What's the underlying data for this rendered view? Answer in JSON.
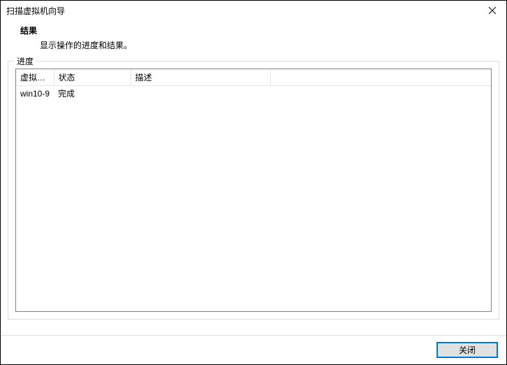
{
  "window": {
    "title": "扫描虚拟机向导"
  },
  "header": {
    "title": "结果",
    "subtitle": "显示操作的进度和结果。"
  },
  "groupbox": {
    "label": "进度"
  },
  "table": {
    "columns": {
      "vm": "虚拟…",
      "status": "状态",
      "description": "描述"
    },
    "rows": [
      {
        "vm": "win10-9",
        "status": "完成",
        "description": ""
      }
    ]
  },
  "footer": {
    "close_label": "关闭"
  }
}
